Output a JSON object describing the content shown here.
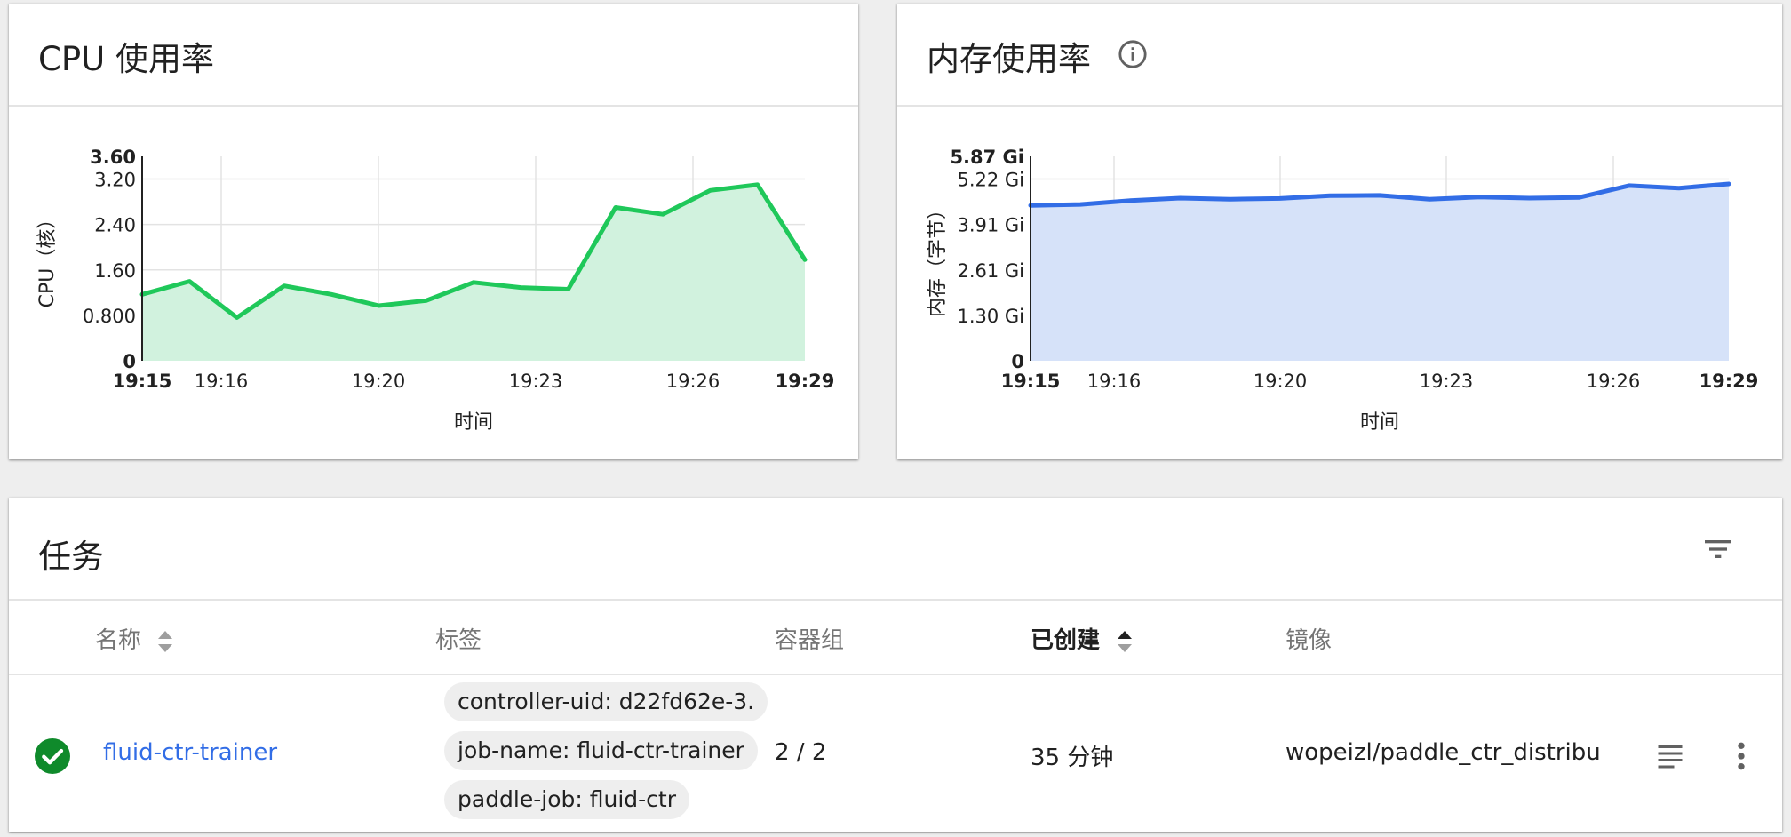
{
  "cpu_card": {
    "title": "CPU 使用率",
    "color": "#1fc85a",
    "fill": "#d1f2de",
    "chart_data": {
      "type": "area",
      "title": "CPU 使用率",
      "xlabel": "时间",
      "ylabel": "CPU（核）",
      "x_ticks": [
        "19:15",
        "19:16",
        "19:20",
        "19:23",
        "19:26",
        "19:29"
      ],
      "y_ticks": [
        "0",
        "0.800",
        "1.60",
        "2.40",
        "3.20",
        "3.60"
      ],
      "ylim": [
        0,
        3.6
      ],
      "x_range": [
        "19:15",
        "19:29"
      ],
      "grid": true,
      "values": [
        1.17,
        1.4,
        0.76,
        1.32,
        1.17,
        0.97,
        1.06,
        1.38,
        1.29,
        1.26,
        2.7,
        2.58,
        3.0,
        3.1,
        1.78
      ]
    }
  },
  "mem_card": {
    "title": "内存使用率",
    "info_icon": "info-icon",
    "color": "#326de6",
    "fill": "#d6e2f9",
    "chart_data": {
      "type": "area",
      "title": "内存使用率",
      "xlabel": "时间",
      "ylabel": "内存（字节）",
      "x_ticks": [
        "19:15",
        "19:16",
        "19:20",
        "19:23",
        "19:26",
        "19:29"
      ],
      "y_ticks": [
        "0",
        "1.30 Gi",
        "2.61 Gi",
        "3.91 Gi",
        "5.22 Gi",
        "5.87 Gi"
      ],
      "ylim": [
        0,
        5.87
      ],
      "y_unit": "Gi",
      "x_range": [
        "19:15",
        "19:29"
      ],
      "grid": true,
      "values": [
        4.46,
        4.49,
        4.6,
        4.67,
        4.64,
        4.66,
        4.74,
        4.75,
        4.64,
        4.7,
        4.67,
        4.69,
        5.03,
        4.96,
        5.08
      ]
    }
  },
  "jobs": {
    "title": "任务",
    "filter_icon": "filter-icon",
    "columns": {
      "name": "名称",
      "labels": "标签",
      "pods": "容器组",
      "created": "已创建",
      "image": "镜像"
    },
    "rows": [
      {
        "status_icon": "check-circle-icon",
        "status_color": "#0f8a2b",
        "name": "fluid-ctr-trainer",
        "labels": [
          "controller-uid: d22fd62e-3.",
          "job-name: fluid-ctr-trainer",
          "paddle-job: fluid-ctr"
        ],
        "pods": "2 / 2",
        "created": "35 分钟",
        "image": "wopeizl/paddle_ctr_distribu"
      }
    ]
  }
}
